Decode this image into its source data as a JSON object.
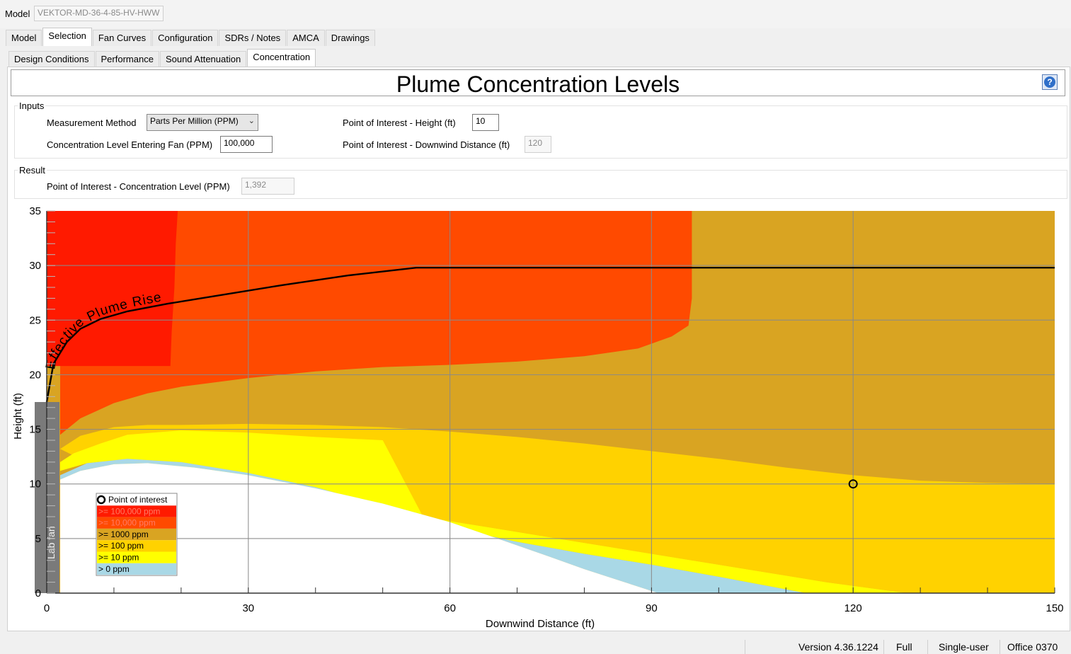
{
  "model": {
    "label": "Model",
    "value": "VEKTOR-MD-36-4-85-HV-HWW"
  },
  "main_tabs": [
    "Model",
    "Selection",
    "Fan Curves",
    "Configuration",
    "SDRs / Notes",
    "AMCA",
    "Drawings"
  ],
  "main_tab_active": "Selection",
  "sub_tabs": [
    "Design Conditions",
    "Performance",
    "Sound Attenuation",
    "Concentration"
  ],
  "sub_tab_active": "Concentration",
  "page_title": "Plume Concentration Levels",
  "help_icon": "help-icon",
  "inputs": {
    "group_label": "Inputs",
    "measurement_method_label": "Measurement Method",
    "measurement_method_value": "Parts Per Million (PPM)",
    "conc_entering_label": "Concentration Level Entering Fan (PPM)",
    "conc_entering_value": "100,000",
    "poi_height_label": "Point of Interest - Height (ft)",
    "poi_height_value": "10",
    "poi_distance_label": "Point of Interest - Downwind Distance (ft)",
    "poi_distance_value": "120"
  },
  "result": {
    "group_label": "Result",
    "poi_conc_label": "Point of Interest - Concentration Level (PPM)",
    "poi_conc_value": "1,392"
  },
  "status": {
    "version": "Version 4.36.1224",
    "edition": "Full",
    "license": "Single-user",
    "office": "Office 0370"
  },
  "chart_data": {
    "type": "area",
    "xlabel": "Downwind Distance (ft)",
    "ylabel": "Height (ft)",
    "xlim": [
      0,
      150
    ],
    "ylim": [
      0,
      35
    ],
    "x_ticks": [
      0,
      30,
      60,
      90,
      120,
      150
    ],
    "y_ticks": [
      0,
      5,
      10,
      15,
      20,
      25,
      30,
      35
    ],
    "grid": true,
    "legend_position": "bottom-left",
    "legend": [
      {
        "label": "Point of interest",
        "marker": "circle"
      },
      {
        "label": ">= 100,000 ppm",
        "color": "#ff1a00"
      },
      {
        "label": ">= 10,000 ppm",
        "color": "#ff4a00"
      },
      {
        "label": ">= 1000 ppm",
        "color": "#d9a422"
      },
      {
        "label": ">= 100 ppm",
        "color": "#ffd200"
      },
      {
        "label": ">= 10 ppm",
        "color": "#ffff00"
      },
      {
        "label": "> 0 ppm",
        "color": "#a9d8e6"
      }
    ],
    "fan_label": "Lab fan",
    "fan_height": 17.5,
    "fan_color": "#7a7a7a",
    "plume_label": "Effective Plume Rise",
    "plume_rise": {
      "x": [
        0,
        1,
        3,
        5,
        8,
        12,
        18,
        25,
        35,
        45,
        55,
        150
      ],
      "y": [
        17.5,
        21,
        23,
        24.2,
        25.1,
        25.8,
        26.5,
        27.2,
        28.2,
        29.1,
        29.8,
        29.8
      ]
    },
    "point_of_interest": {
      "x": 120,
      "y": 10
    },
    "zones": [
      {
        "name": ">= 10,000 ppm",
        "color": "#ff4a00",
        "x": [
          2,
          5,
          10,
          15,
          20,
          30,
          40,
          50,
          60,
          70,
          80,
          88,
          93,
          95.5,
          96,
          96,
          2
        ],
        "y": [
          14.5,
          16,
          17.4,
          18.3,
          18.9,
          19.7,
          20.3,
          20.7,
          20.9,
          21.2,
          21.7,
          22.4,
          23.5,
          24.5,
          27,
          35,
          35
        ]
      },
      {
        "name": ">= 100,000 ppm",
        "color": "#ff1a00",
        "x": [
          0,
          19.5,
          19.2,
          19,
          18.6,
          18.4,
          0
        ],
        "y": [
          35,
          35,
          32,
          28,
          24,
          20.8,
          20.8
        ]
      },
      {
        "name": ">= 100 ppm",
        "color": "#ffd200",
        "x": [
          2,
          5,
          10,
          15,
          20,
          30,
          40,
          50,
          60,
          70,
          80,
          90,
          100,
          110,
          120,
          130,
          140,
          150,
          150,
          128,
          116,
          106,
          96,
          86,
          76,
          66,
          56,
          46,
          36,
          26,
          16,
          8,
          4,
          2
        ],
        "y": [
          13.2,
          14.4,
          15.2,
          15.4,
          15.4,
          15.5,
          15.4,
          15.2,
          14.8,
          14.3,
          13.7,
          13,
          12.3,
          11.5,
          10.8,
          10.3,
          10.1,
          10,
          0,
          0,
          1,
          2,
          3,
          4,
          5,
          6,
          7,
          8,
          9,
          10,
          11,
          12,
          12.6,
          13.2
        ]
      },
      {
        "name": ">= 10 ppm",
        "color": "#ffff00",
        "x": [
          2,
          4,
          8,
          12,
          20,
          30,
          40,
          50,
          56,
          66,
          76,
          86,
          96,
          106,
          116,
          128,
          113,
          100,
          90,
          80,
          70,
          60,
          50,
          40,
          30,
          20,
          12,
          6,
          2
        ],
        "y": [
          12,
          12.8,
          13.7,
          14.5,
          14.9,
          14.7,
          14.3,
          14,
          7,
          6,
          5,
          4,
          3,
          2,
          1,
          0,
          0,
          1.5,
          2.6,
          3.6,
          4.7,
          6,
          8,
          9.7,
          11,
          12,
          12.3,
          11.9,
          11.2
        ]
      },
      {
        "name": "> 0 ppm",
        "color": "#a9d8e6",
        "x": [
          2,
          6,
          12,
          20,
          30,
          40,
          50,
          60,
          70,
          80,
          90,
          100,
          113,
          91,
          85,
          80,
          75,
          68,
          60,
          50,
          40,
          30,
          22,
          15,
          10,
          5,
          2
        ],
        "y": [
          10.8,
          11.9,
          12.3,
          12,
          11,
          9.7,
          8,
          6,
          4.7,
          3.6,
          2.6,
          1.5,
          0,
          0,
          1.2,
          2.2,
          3.3,
          4.8,
          6.5,
          8.2,
          9.6,
          10.8,
          11.5,
          11.9,
          11.8,
          11.2,
          10.4
        ]
      },
      {
        "name": "no concentration",
        "color": "#ffffff",
        "x": [
          2,
          5,
          10,
          15,
          22,
          30,
          40,
          50,
          60,
          68,
          75,
          80,
          85,
          91,
          2
        ],
        "y": [
          10.4,
          11.2,
          11.8,
          11.9,
          11.5,
          10.8,
          9.6,
          8.2,
          6.5,
          4.8,
          3.3,
          2.2,
          1.2,
          0,
          0
        ]
      }
    ]
  }
}
